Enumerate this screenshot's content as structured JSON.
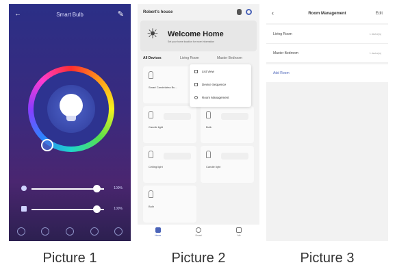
{
  "picture1": {
    "title": "Smart Bulb",
    "brightness_level_percent": 90,
    "temperature_level_percent": 90
  },
  "picture2": {
    "home_name": "Robert's house",
    "welcome_title": "Welcome Home",
    "welcome_subtitle": "Set your home location for more information",
    "tabs": [
      "All Devices",
      "Living Room",
      "Master Bedroom"
    ],
    "devices": [
      "Smart Candelabra Bu...",
      "Candle light",
      "Bulb",
      "Ceiling light",
      "Candle light",
      "Bulb"
    ],
    "menu": [
      "List View",
      "Device Sequence",
      "Room Management"
    ],
    "nav": [
      "Home",
      "Smart",
      "Me"
    ]
  },
  "picture3": {
    "title": "Room Management",
    "edit": "Edit",
    "rooms": [
      {
        "name": "Living Room",
        "count": "1 device(s)"
      },
      {
        "name": "Master Bedroom",
        "count": "1 device(s)"
      }
    ],
    "add_room": "Add Room"
  },
  "captions": [
    "Picture 1",
    "Picture 2",
    "Picture 3"
  ]
}
